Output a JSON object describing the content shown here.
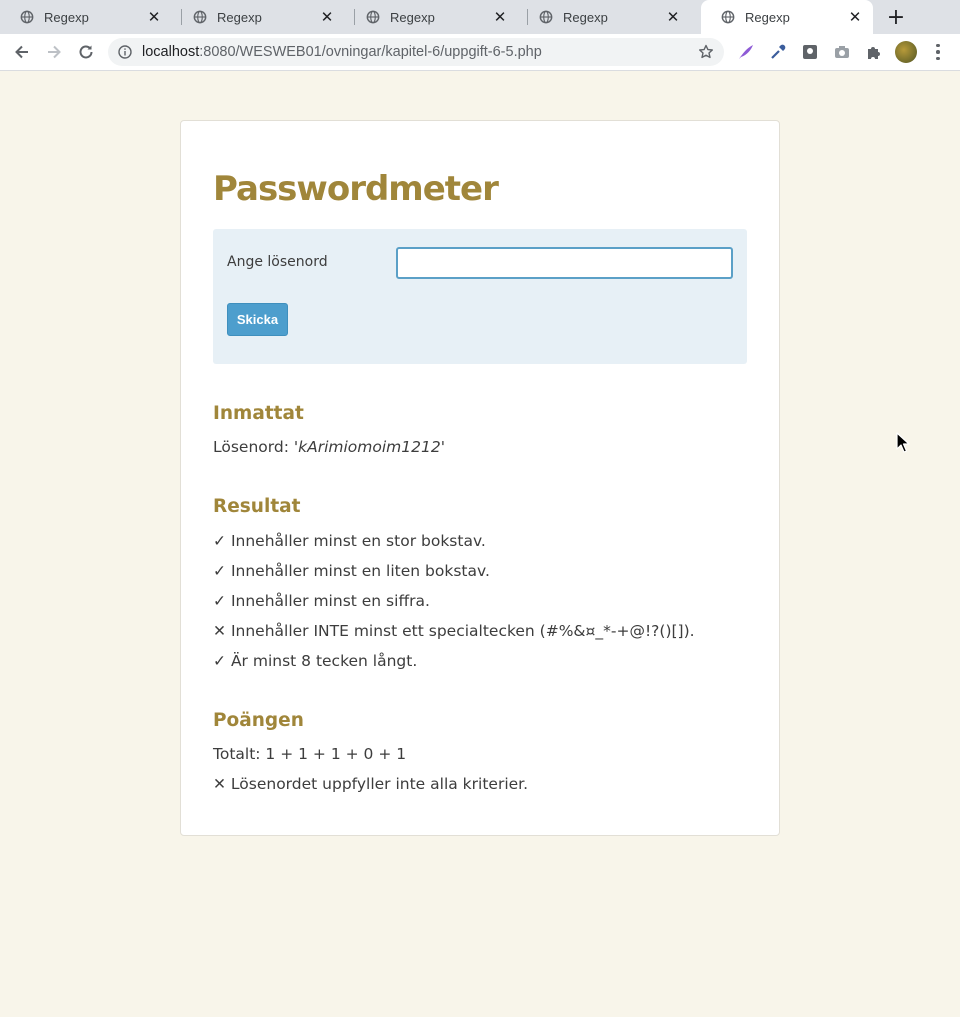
{
  "browser": {
    "tabs": [
      {
        "title": "Regexp",
        "active": false
      },
      {
        "title": "Regexp",
        "active": false
      },
      {
        "title": "Regexp",
        "active": false
      },
      {
        "title": "Regexp",
        "active": false
      },
      {
        "title": "Regexp",
        "active": true
      }
    ],
    "url_host": "localhost",
    "url_path": ":8080/WESWEB01/ovningar/kapitel-6/uppgift-6-5.php"
  },
  "page": {
    "title": "Passwordmeter",
    "form": {
      "label": "Ange lösenord",
      "input_value": "",
      "submit_label": "Skicka"
    },
    "entered": {
      "heading": "Inmattat",
      "label": "Lösenord:",
      "value": "'kArimiomoim1212'"
    },
    "result": {
      "heading": "Resultat",
      "items": [
        {
          "mark": "✓",
          "text": "Innehåller minst en stor bokstav."
        },
        {
          "mark": "✓",
          "text": "Innehåller minst en liten bokstav."
        },
        {
          "mark": "✓",
          "text": "Innehåller minst en siffra."
        },
        {
          "mark": "✕",
          "text": "Innehåller INTE minst ett specialtecken (#%&¤_*-+@!?()[])."
        },
        {
          "mark": "✓",
          "text": "Är minst 8 tecken långt."
        }
      ]
    },
    "score": {
      "heading": "Poängen",
      "total": "Totalt: 1 + 1 + 1 + 0 + 1",
      "verdict": "✕ Lösenordet uppfyller inte alla kriterier."
    }
  },
  "colors": {
    "page_bg": "#f8f5ea",
    "heading": "#a0863a",
    "form_bg": "#e7f0f6",
    "button": "#4d9ecd"
  }
}
